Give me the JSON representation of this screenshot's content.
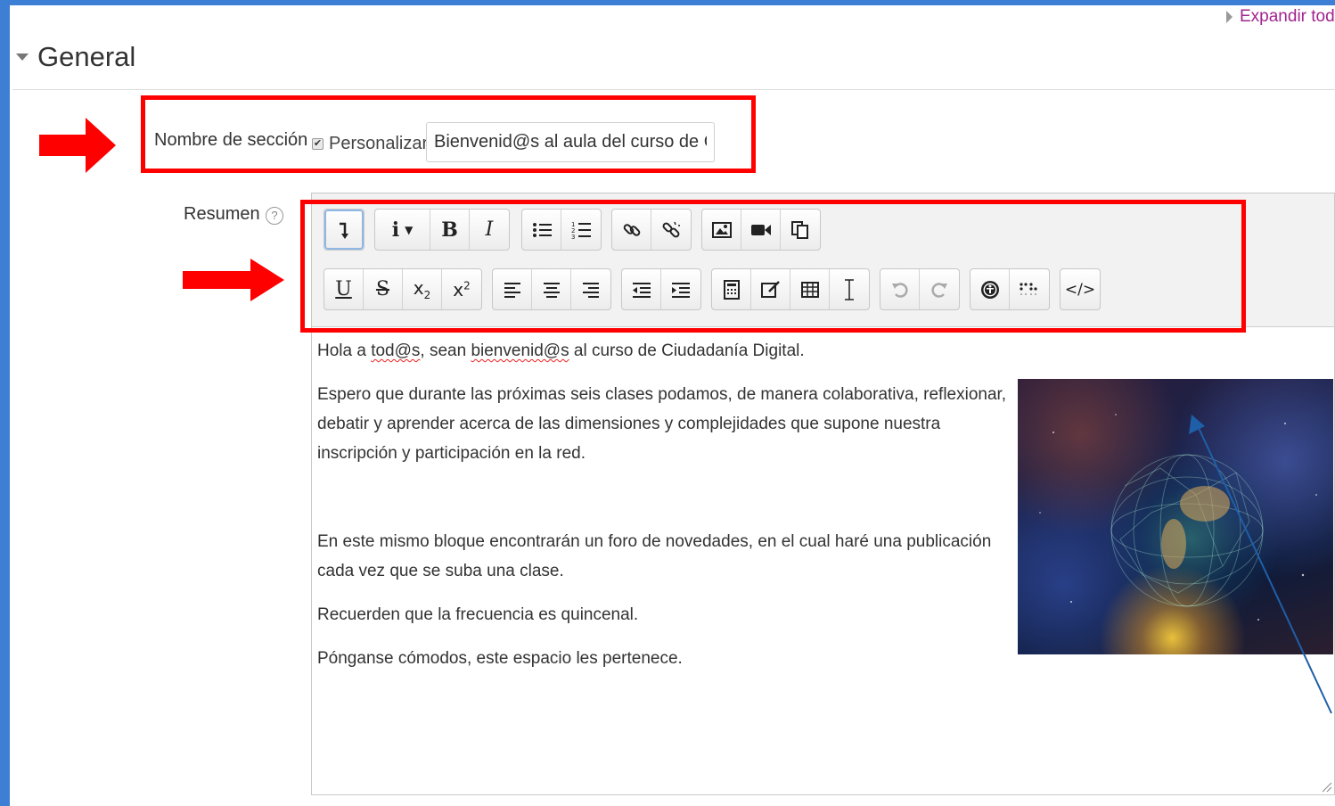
{
  "header": {
    "expand_all": "Expandir todo",
    "section_title": "General"
  },
  "form": {
    "section_name_label": "Nombre de sección",
    "customize_label": "Personalizar",
    "customize_checked": true,
    "section_name_value": "Bienvenid@s al aula del curso de Ciuda",
    "summary_label": "Resumen",
    "help_icon": "question-circle-icon"
  },
  "toolbar": {
    "row1": [
      [
        "collapse-toolbar-button"
      ],
      [
        "text-style-dropdown",
        "bold-button",
        "italic-button"
      ],
      [
        "unordered-list-button",
        "ordered-list-button"
      ],
      [
        "link-button",
        "unlink-button"
      ],
      [
        "image-button",
        "media-button",
        "manage-files-button"
      ]
    ],
    "row2": [
      [
        "underline-button",
        "strikethrough-button",
        "subscript-button",
        "superscript-button"
      ],
      [
        "align-left-button",
        "align-center-button",
        "align-right-button"
      ],
      [
        "outdent-button",
        "indent-button"
      ],
      [
        "equation-button",
        "special-character-button",
        "table-button",
        "clear-formatting-button"
      ],
      [
        "undo-button",
        "redo-button"
      ],
      [
        "accessibility-checker-button",
        "screenreader-helper-button"
      ],
      [
        "html-source-button"
      ]
    ]
  },
  "content": {
    "p1_before": "Hola a ",
    "p1_word1": "tod@s",
    "p1_mid": ", sean ",
    "p1_word2": "bienvenid@s",
    "p1_after": " al curso de Ciudadanía Digital.",
    "p2": "Espero que durante las próximas seis clases podamos, de manera colaborativa,  reflexionar, debatir y aprender acerca de las dimensiones y complejidades que supone nuestra inscripción y participación en la red.",
    "p3": "En este mismo bloque encontrarán un foro de novedades, en el cual haré una publicación cada vez que se suba una clase.",
    "p4": "Recuerden que la frecuencia es quincenal.",
    "p5": "Pónganse cómodos, este espacio les pertenece."
  },
  "colors": {
    "frame": "#3e7fd6",
    "highlight_box": "#ff0000",
    "link": "#a1248e",
    "annotation_arrow": "#1f5fa8"
  }
}
